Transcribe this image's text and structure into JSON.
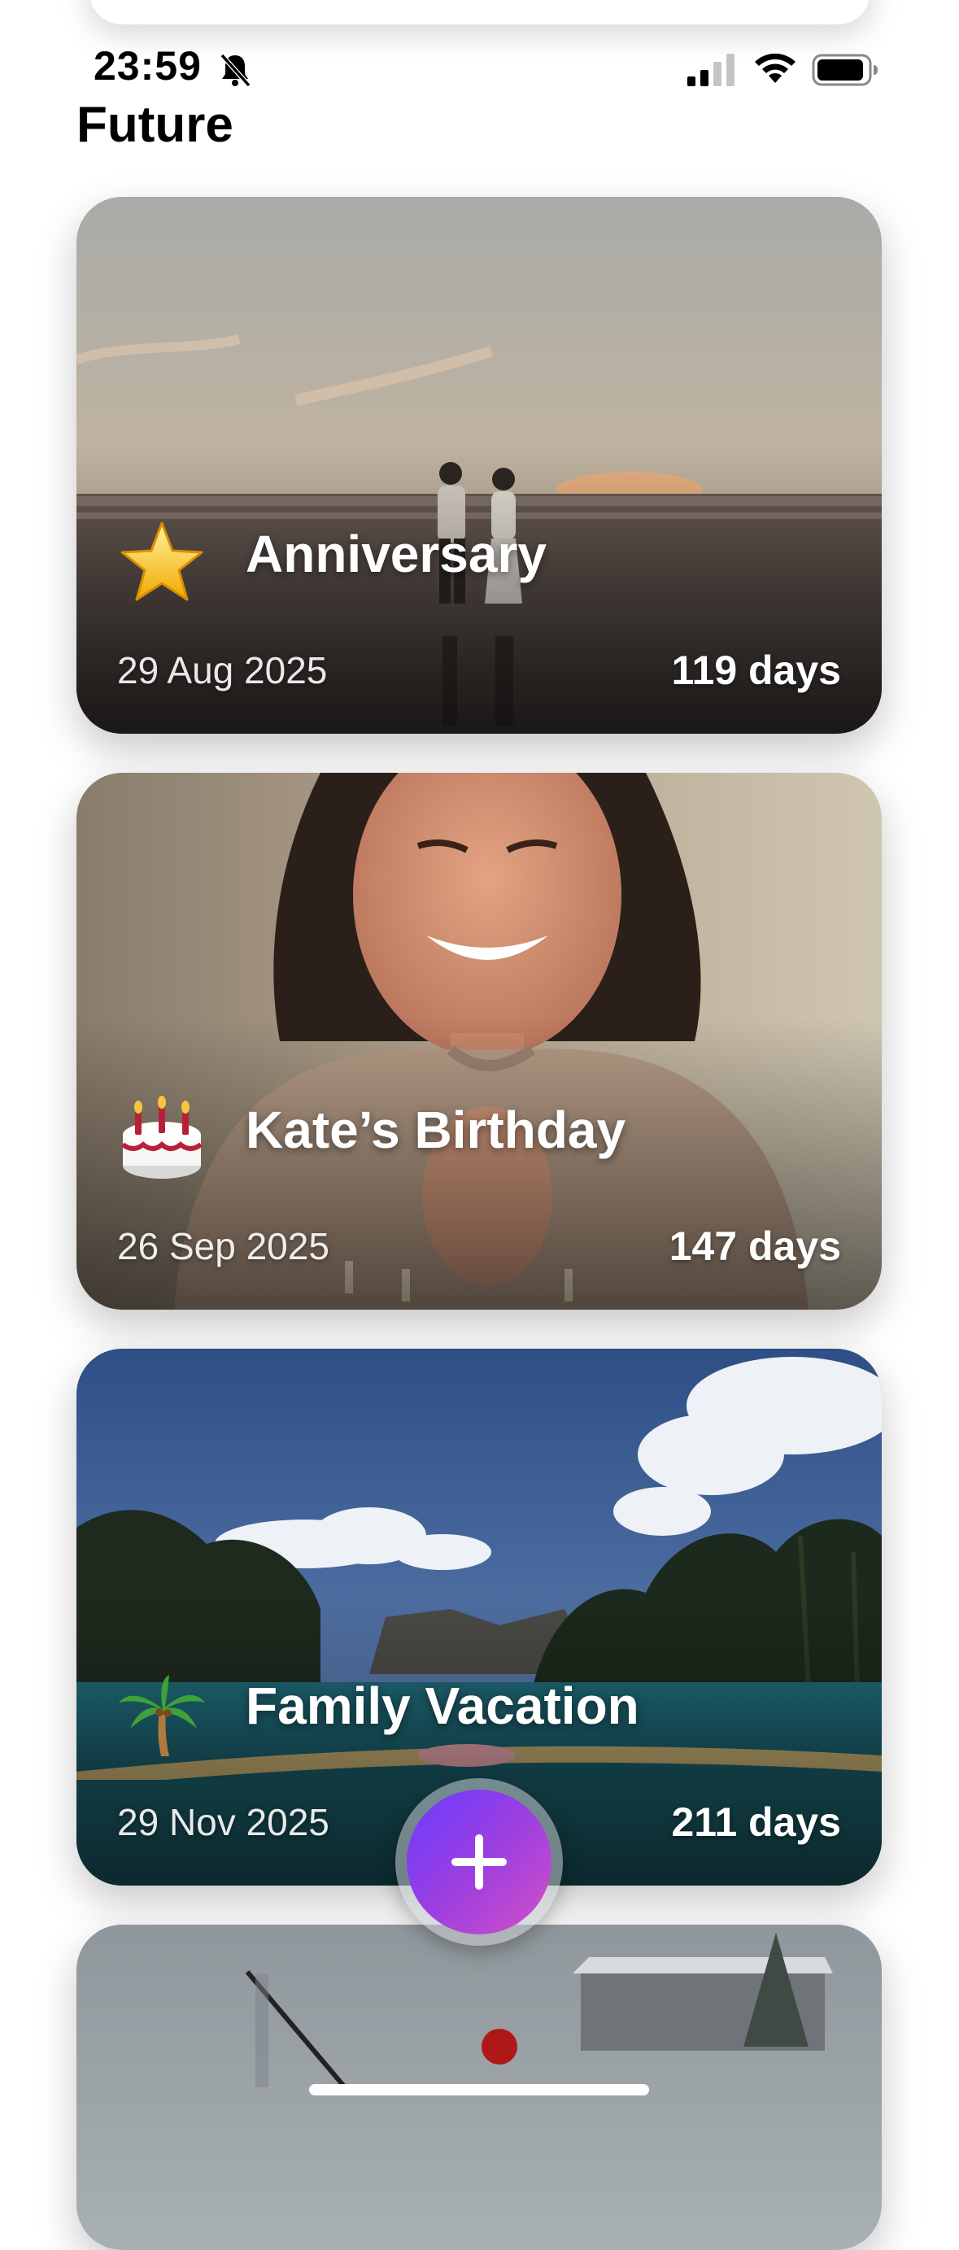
{
  "status_bar": {
    "time": "23:59",
    "mute_icon": "bell-slash-icon",
    "signal_icon": "cellular-signal-icon",
    "wifi_icon": "wifi-icon",
    "battery_icon": "battery-icon"
  },
  "page_title": "Future",
  "events": [
    {
      "icon": "star-emoji",
      "title": "Anniversary",
      "date": "29 Aug 2025",
      "days": "119 days",
      "image": "couple walking on beach at sunset"
    },
    {
      "icon": "birthday-cake-emoji",
      "title": "Kate’s Birthday",
      "date": "26 Sep 2025",
      "days": "147 days",
      "image": "smiling woman with hands clasped"
    },
    {
      "icon": "palm-tree-emoji",
      "title": "Family Vacation",
      "date": "29 Nov 2025",
      "days": "211 days",
      "image": "tropical pool with palm trees"
    },
    {
      "icon": "",
      "title": "",
      "date": "",
      "days": "",
      "image": "foggy mountain scene"
    }
  ],
  "fab": {
    "icon": "plus-icon",
    "colors": [
      "#6a3cff",
      "#d44fc8"
    ]
  }
}
